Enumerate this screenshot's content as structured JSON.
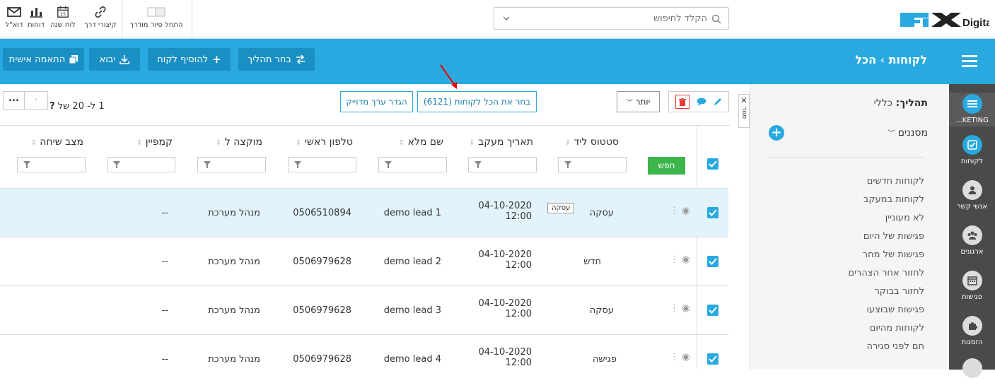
{
  "toolbar": {
    "items": [
      {
        "label": "דוא\"ל",
        "icon": "envelope-icon"
      },
      {
        "label": "דוחות",
        "icon": "bar-chart-icon"
      },
      {
        "label": "לוח שנה",
        "icon": "calendar-icon",
        "day": "25"
      },
      {
        "label": "קיצורי דרך",
        "icon": "link-icon"
      },
      {
        "label": "התחל סיור מודרך",
        "icon": "toggle-icon"
      }
    ],
    "search_placeholder": "הקלד לחיפוש"
  },
  "logo": {
    "text": "Digital",
    "brand": "FIX"
  },
  "header": {
    "breadcrumb_root": "לקוחות",
    "breadcrumb_sep": "›",
    "breadcrumb_current": "הכל",
    "buttons": {
      "personalize": "התאמה אישית",
      "import": "יבוא",
      "add_customer": "להוסיף לקוח",
      "choose_process": "בחר תהליך"
    }
  },
  "sidenav": {
    "items": [
      {
        "label": "...KETING",
        "icon": "menu-icon"
      },
      {
        "label": "לקוחות",
        "icon": "checkbox-icon"
      },
      {
        "label": "אנשי קשר",
        "icon": "person-icon"
      },
      {
        "label": "ארגונים",
        "icon": "group-icon"
      },
      {
        "label": "פגישות",
        "icon": "calendar-icon"
      },
      {
        "label": "הזמנות",
        "icon": "puzzle-icon"
      }
    ]
  },
  "panel": {
    "process_label": "תהליך:",
    "process_value": "כללי",
    "filters_label": "מסננים",
    "links": [
      "לקוחות חדשים",
      "לקוחות במעקב",
      "לא מעוניין",
      "פגישות של היום",
      "פגישות של מחר",
      "לחזור אחר הצהרים",
      "לחזור בבוקר",
      "פגישות שבוצעו",
      "לקוחות מהיום",
      "חם לפני סגירה"
    ]
  },
  "listbar": {
    "collapse_label": "סגור",
    "more_label": "יותר",
    "select_all": "בחר את הכל לקוחות (6121)",
    "set_exact": "הגדר ערך מדוייק",
    "pagination": "1 ל- 20 של",
    "pagination_q": "?",
    "ellipsis": "..."
  },
  "table": {
    "search_button": "חפש",
    "columns": [
      "סטטוס ליד",
      "תאריך מעקב",
      "שם מלא",
      "טלפון ראשי",
      "מוקצה ל",
      "קמפיין",
      "מצב שיחה"
    ],
    "rows": [
      {
        "status": "עסקה",
        "badge": "עסקה",
        "date": "04-10-2020",
        "time": "12:00",
        "name": "demo lead 1",
        "phone": "0506510894",
        "assigned": "מנהל מערכת",
        "campaign": "--",
        "call": ""
      },
      {
        "status": "חדש",
        "badge": "",
        "date": "04-10-2020",
        "time": "12:00",
        "name": "demo lead 2",
        "phone": "0506979628",
        "assigned": "מנהל מערכת",
        "campaign": "--",
        "call": ""
      },
      {
        "status": "עסקה",
        "badge": "",
        "date": "04-10-2020",
        "time": "12:00",
        "name": "demo lead 3",
        "phone": "0506979628",
        "assigned": "מנהל מערכת",
        "campaign": "--",
        "call": ""
      },
      {
        "status": "פגישה",
        "badge": "",
        "date": "04-10-2020",
        "time": "12:00",
        "name": "demo lead 4",
        "phone": "0506979628",
        "assigned": "מנהל מערכת",
        "campaign": "--",
        "call": ""
      }
    ]
  },
  "colors": {
    "brand": "#29a9e0",
    "dark": "#4a4a4a",
    "green": "#3cb54a",
    "red": "#e53935",
    "highlight": "#e3f3fb"
  }
}
